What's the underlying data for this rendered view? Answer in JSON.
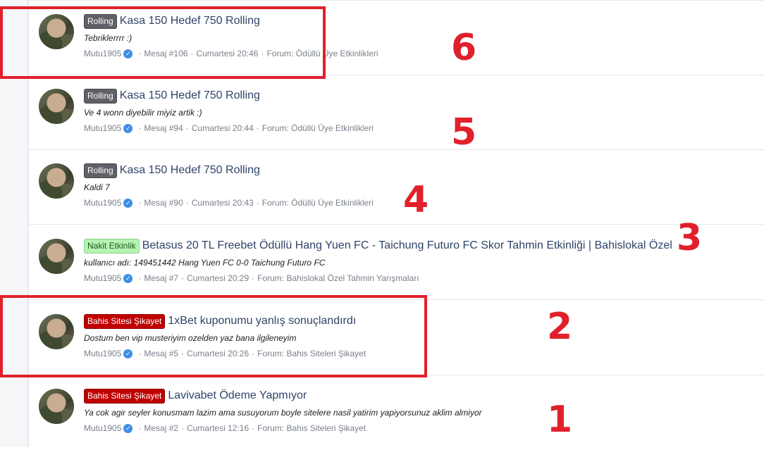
{
  "results": [
    {
      "badge": "Rolling",
      "badge_style": "gray",
      "title": "Kasa 150 Hedef 750 Rolling",
      "snippet": "Tebriklerrrr :)",
      "user": "Mutu1905",
      "post": "Mesaj #106",
      "date": "Cumartesi 20:46",
      "forum": "Forum: Ödüllü Üye Etkinlikleri"
    },
    {
      "badge": "Rolling",
      "badge_style": "gray",
      "title": "Kasa 150 Hedef 750 Rolling",
      "snippet": "Ve 4 wonn diyebilir miyiz artik :)",
      "user": "Mutu1905",
      "post": "Mesaj #94",
      "date": "Cumartesi 20:44",
      "forum": "Forum: Ödüllü Üye Etkinlikleri"
    },
    {
      "badge": "Rolling",
      "badge_style": "gray",
      "title": "Kasa 150 Hedef 750 Rolling",
      "snippet": "Kaldi 7",
      "user": "Mutu1905",
      "post": "Mesaj #90",
      "date": "Cumartesi 20:43",
      "forum": "Forum: Ödüllü Üye Etkinlikleri"
    },
    {
      "badge": "Nakit Etkinlik",
      "badge_style": "green",
      "title": "Betasus 20 TL Freebet Ödüllü Hang Yuen FC - Taichung Futuro FC Skor Tahmin Etkinliği | Bahislokal Özel",
      "snippet": "kullanıcı adı: 149451442 Hang Yuen FC 0-0 Taichung Futuro FC",
      "user": "Mutu1905",
      "post": "Mesaj #7",
      "date": "Cumartesi 20:29",
      "forum": "Forum: Bahislokal Özel Tahmin Yarışmaları"
    },
    {
      "badge": "Bahis Sitesi Şikayet",
      "badge_style": "red",
      "title": "1xBet kuponumu yanlış sonuçlandırdı",
      "snippet": "Dostum ben vip musteriyim ozelden yaz bana ilgileneyim",
      "user": "Mutu1905",
      "post": "Mesaj #5",
      "date": "Cumartesi 20:26",
      "forum": "Forum: Bahis Siteleri Şikayet"
    },
    {
      "badge": "Bahis Sitesi Şikayet",
      "badge_style": "red",
      "title": "Lavivabet Ödeme Yapmıyor",
      "snippet": "Ya cok agir seyler konusmam lazim ama susuyorum boyle sitelere nasil yatirim yapiyorsunuz aklim almiyor",
      "user": "Mutu1905",
      "post": "Mesaj #2",
      "date": "Cumartesi 12:16",
      "forum": "Forum: Bahis Siteleri Şikayet"
    }
  ],
  "separator": "·",
  "annotations": [
    "6",
    "5",
    "4",
    "3",
    "2",
    "1"
  ],
  "annotation_color": "#e0202b",
  "verified_icon": "check-badge-icon"
}
